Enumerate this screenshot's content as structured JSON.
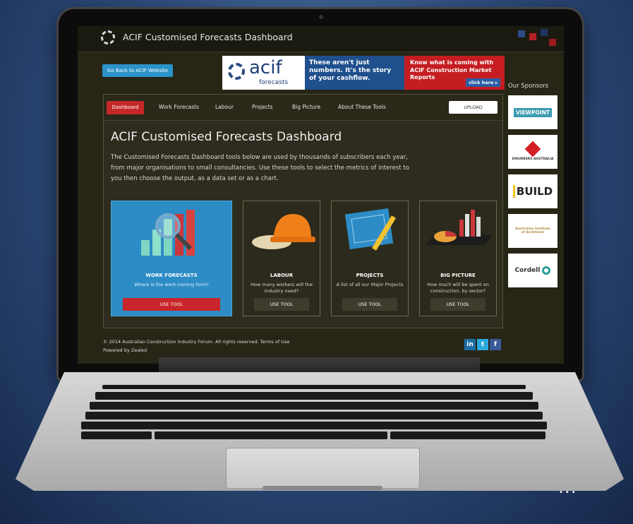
{
  "app": {
    "title": "ACIF Customised Forecasts Dashboard"
  },
  "header": {
    "back_button": "Go Back to ACIF Website",
    "banner": {
      "logo_text": "acif",
      "logo_sub": "forecasts",
      "middle_text": "These aren't just numbers. It's the story of your cashflow.",
      "right_text": "Know what is coming with ACIF Construction Market Reports",
      "cta": "click here ▸"
    }
  },
  "nav": {
    "items": [
      "Dashboard",
      "Work Forecasts",
      "Labour",
      "Projects",
      "Big Picture",
      "About These Tools"
    ],
    "upload": "UPLOAD"
  },
  "main": {
    "title": "ACIF Customised Forecasts Dashboard",
    "description": "The Customised Forecasts Dashboard tools below are used by thousands of subscribers each year, from major organisations to small consultancies. Use these tools to select the metrics of interest to you then choose the output, as a data set or as a chart.",
    "cards": [
      {
        "title": "WORK FORECASTS",
        "subtitle": "Where is the work coming form?",
        "button": "USE TOOL"
      },
      {
        "title": "LABOUR",
        "subtitle": "How many workers will the industry need?",
        "button": "USE TOOL"
      },
      {
        "title": "PROJECTS",
        "subtitle": "A list of all our Major Projects",
        "button": "USE TOOL"
      },
      {
        "title": "BIG PICTURE",
        "subtitle": "How much will be spent on construction, by sector?",
        "button": "USE TOOL"
      }
    ]
  },
  "sidebar": {
    "title": "Our Sponsors",
    "sponsors": [
      "VIEWPOINT",
      "ENGINEERS AUSTRALIA",
      "BUILD",
      "Australian Institute of Architects",
      "Cordell"
    ]
  },
  "footer": {
    "line1": "© 2014 Australian Construction Industry Forum. All rights reserved. Terms of Use",
    "line2": "Powered by Zealed",
    "social": [
      "in",
      "t",
      "f"
    ]
  },
  "colors": {
    "accent_red": "#c5282a",
    "accent_blue": "#2d8cc5",
    "panel_bg": "#2e2c1e"
  }
}
